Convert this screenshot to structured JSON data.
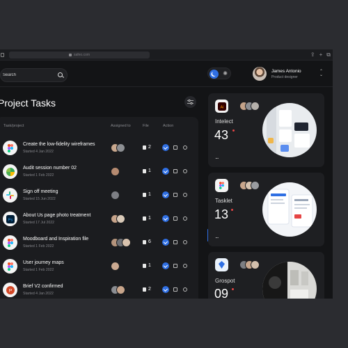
{
  "browser": {
    "url": "safeo.com"
  },
  "header": {
    "search_placeholder": "Search",
    "user": {
      "name": "James Antonio",
      "role": "Product designer"
    }
  },
  "page": {
    "title": "Project Tasks"
  },
  "table": {
    "columns": [
      "Task/project",
      "Assigned to",
      "File",
      "Action"
    ],
    "rows": [
      {
        "name": "Create the low-fidelity wireframes",
        "date": "Started 4 Jan 2022",
        "files": "2",
        "icon": "figma-icon",
        "assignees": 2
      },
      {
        "name": "Audit session number 02",
        "date": "Started 1 Feb 2022",
        "files": "1",
        "icon": "pinwheel-icon",
        "assignees": 1
      },
      {
        "name": "Sign off meeting",
        "date": "Started 15 Jun 2022",
        "files": "1",
        "icon": "slack-icon",
        "assignees": 1
      },
      {
        "name": "About Us page photo treatment",
        "date": "Started 17 Jul 2022",
        "files": "1",
        "icon": "photoshop-icon",
        "assignees": 2
      },
      {
        "name": "Moodboard and Inspiration file",
        "date": "Started 1 Feb 2022",
        "files": "6",
        "icon": "figma-icon",
        "assignees": 3
      },
      {
        "name": "User journey maps",
        "date": "Started 1 Feb 2022",
        "files": "1",
        "icon": "figma-icon",
        "assignees": 1
      },
      {
        "name": "Brief V2 confirmed",
        "date": "Started 4 Jan 2022",
        "files": "2",
        "icon": "powerpoint-icon",
        "assignees": 2
      }
    ]
  },
  "projects": [
    {
      "name": "Intelect",
      "count": "43",
      "icon": "illustrator-icon",
      "more": "..."
    },
    {
      "name": "Tasklet",
      "count": "13",
      "icon": "figma-icon",
      "more": "..."
    },
    {
      "name": "Grospot",
      "count": "09",
      "icon": "grospot-icon",
      "more": "..."
    }
  ],
  "colors": {
    "accent": "#2f6fe3",
    "alert": "#e54545",
    "background": "#131416",
    "card": "#1e1f22"
  }
}
